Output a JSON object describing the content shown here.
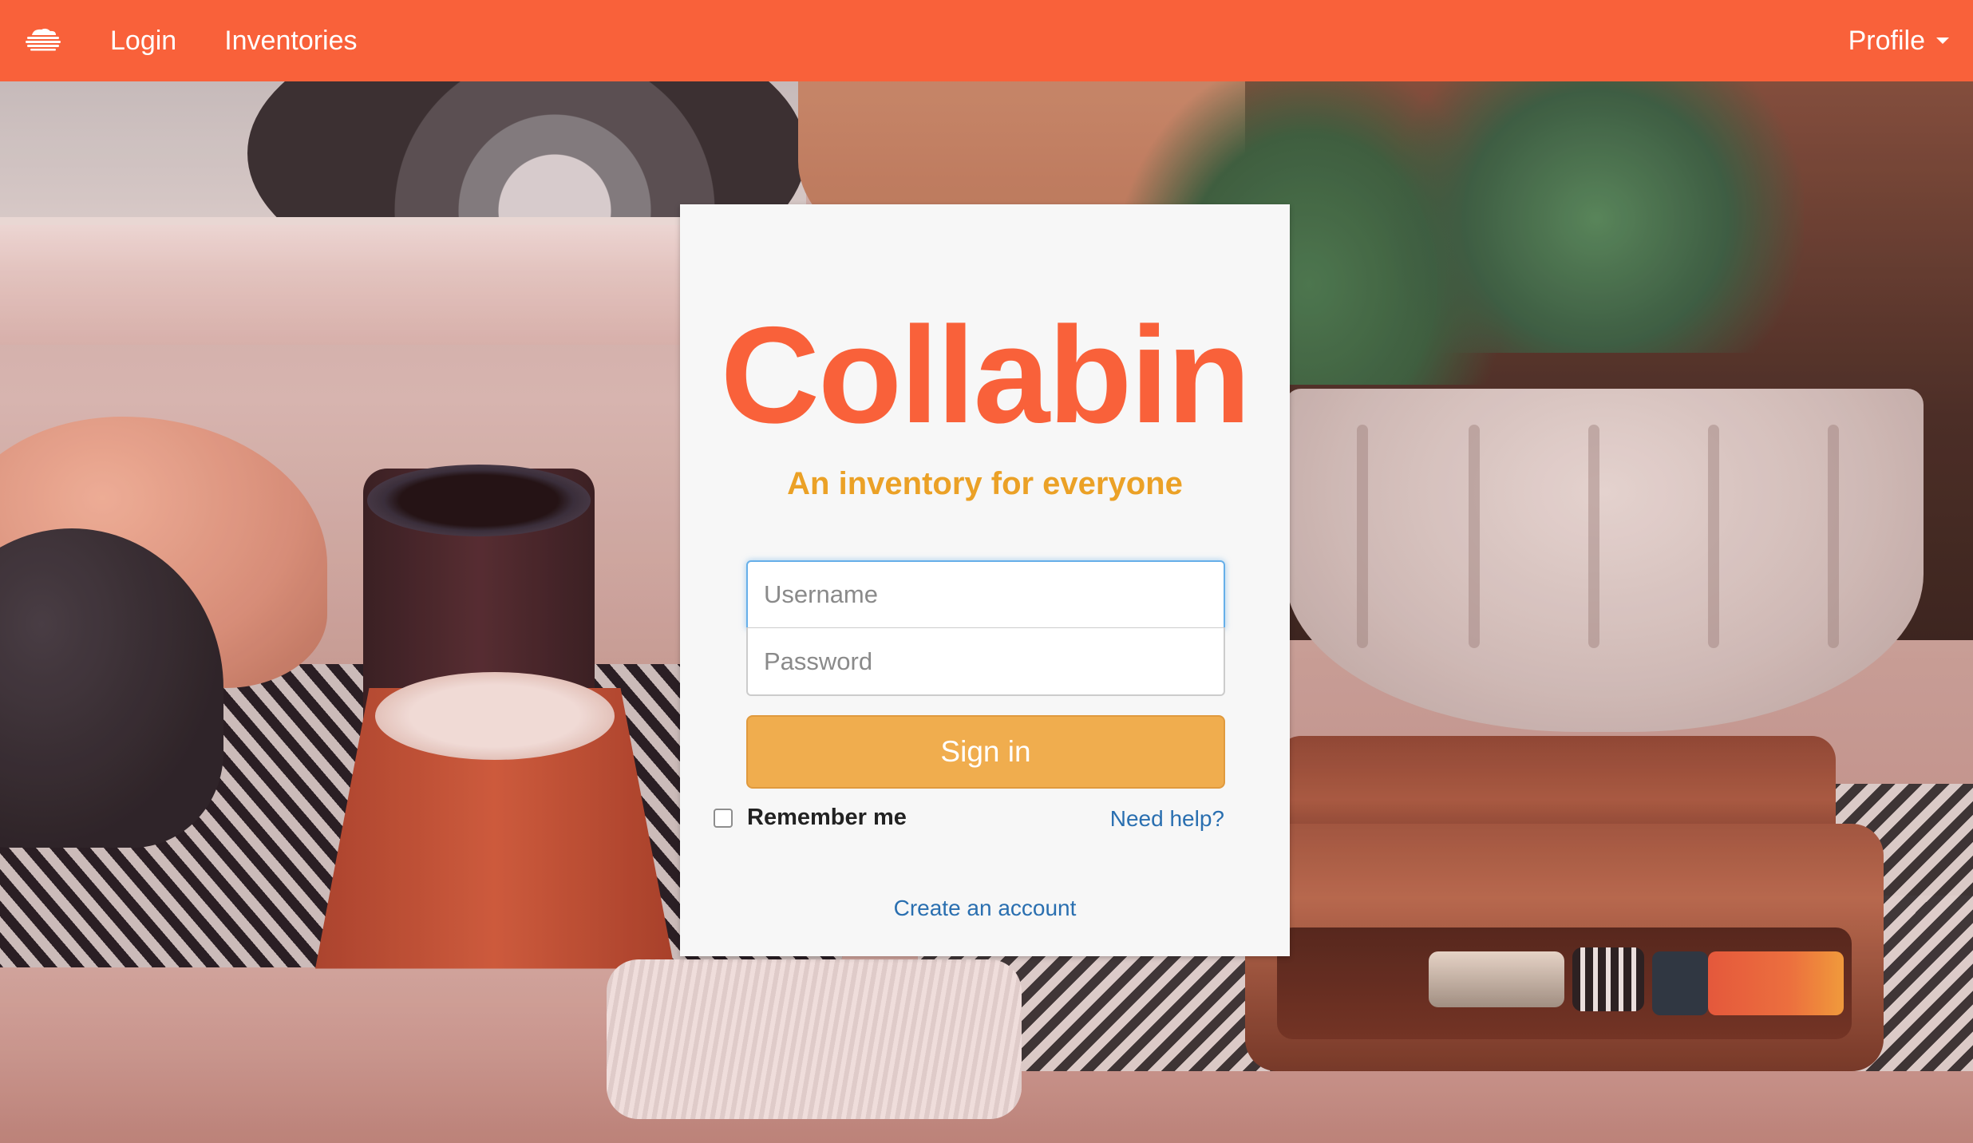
{
  "navbar": {
    "logo_icon": "cloud-stack-icon",
    "links": [
      {
        "label": "Login"
      },
      {
        "label": "Inventories"
      }
    ],
    "profile_label": "Profile",
    "background": "#f9613a"
  },
  "login_card": {
    "title": "Collabin",
    "tagline": "An inventory for everyone",
    "username_placeholder": "Username",
    "password_placeholder": "Password",
    "signin_label": "Sign in",
    "remember_label": "Remember me",
    "remember_checked": false,
    "help_label": "Need help?",
    "create_account_label": "Create an account",
    "colors": {
      "title": "#f9613a",
      "tagline": "#eba126",
      "button": "#f0ad4e",
      "link": "#2a6fb0"
    }
  }
}
